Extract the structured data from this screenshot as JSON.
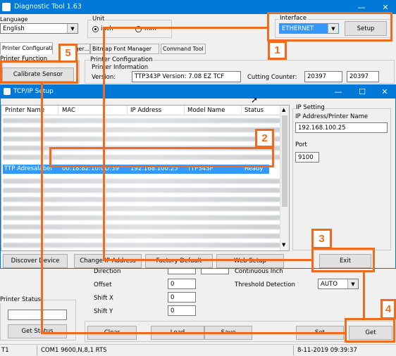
{
  "main_window": {
    "title": "Diagnostic Tool 1.63",
    "language": {
      "label": "Language",
      "value": "English"
    },
    "unit": {
      "label": "Unit",
      "options": [
        "inch",
        "mm"
      ],
      "selected": "inch"
    },
    "interface": {
      "label": "Interface",
      "value": "ETHERNET",
      "setup_label": "Setup"
    },
    "tabs": [
      "Printer Configuration",
      "...anager",
      "Bitmap Font Manager",
      "Command Tool"
    ],
    "printer_function": {
      "label": "Printer Function",
      "calibrate_label": "Calibrate Sensor"
    },
    "printer_configuration": {
      "label": "Printer Configuration",
      "info_label": "Printer Information",
      "version_label": "Version:",
      "version_value": "TTP343P Version: 7.08 EZ TCF",
      "cutting_label": "Cutting Counter:",
      "cutting_value_1": "20397",
      "cutting_value_2": "20397"
    },
    "settings": {
      "direction_label": "Direction",
      "continuous_label": "Continuous Inch",
      "offset_label": "Offset",
      "offset_value": "0",
      "shift_x_label": "Shift X",
      "shift_x_value": "0",
      "shift_y_label": "Shift Y",
      "shift_y_value": "0",
      "threshold_label": "Threshold Detection",
      "threshold_value": "AUTO"
    },
    "printer_status": {
      "label": "Printer Status",
      "get_status_label": "Get Status"
    },
    "bottom_buttons": {
      "clear": "Clear",
      "load": "Load",
      "save": "Save",
      "set": "Set",
      "get": "Get"
    },
    "statusbar": {
      "left": "T1",
      "port": "COM1 9600,N,8,1 RTS",
      "datetime": "8-11-2019 09:39:37"
    }
  },
  "tcpip_dialog": {
    "title": "TCP/IP Setup",
    "columns": [
      "Printer Name",
      "MAC",
      "IP Address",
      "Model Name",
      "Status"
    ],
    "selected_row": {
      "name": "TTP Adresalabel",
      "mac": "00:18:82:10:CD:39",
      "ip": "192.168.100.25",
      "model": "TTP343P",
      "status": "Ready"
    },
    "ip_setting": {
      "group_label": "IP Setting",
      "address_label": "IP Address/Printer Name",
      "address_value": "192.168.100.25",
      "port_label": "Port",
      "port_value": "9100"
    },
    "buttons": {
      "discover": "Discover Device",
      "change_ip": "Change IP Address",
      "factory_default": "Factory Default",
      "web_setup": "Web Setup",
      "exit": "Exit"
    }
  },
  "callouts": [
    "1",
    "2",
    "3",
    "4",
    "5"
  ],
  "colors": {
    "accent": "#f26b1d",
    "titlebar": "#0078d7",
    "selection": "#3399ff"
  }
}
